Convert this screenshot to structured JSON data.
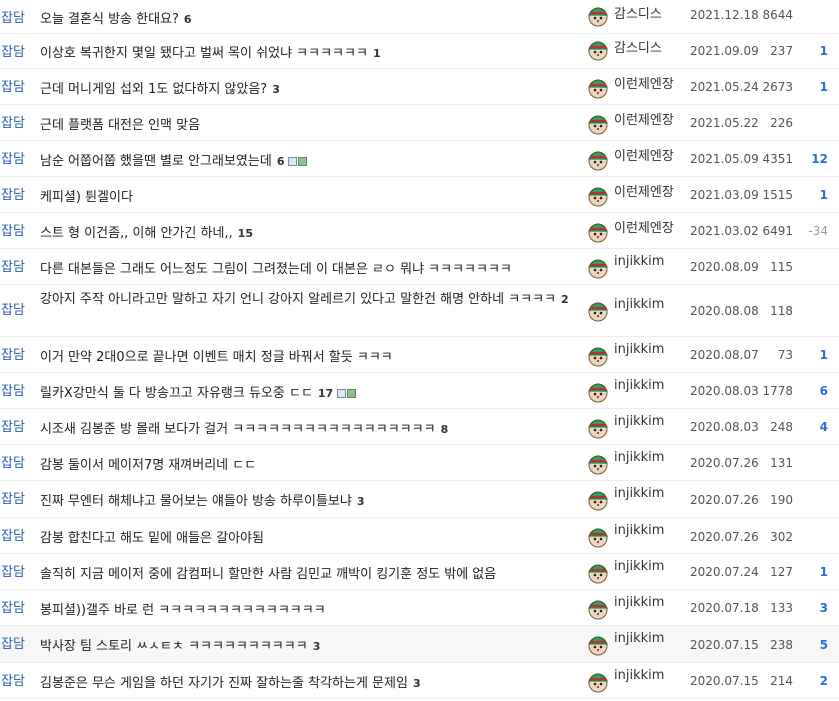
{
  "rows": [
    {
      "category": "잡담",
      "title": "오늘 결혼식 방송 한대요?",
      "comments": "6",
      "attach": false,
      "nick": "감스디스",
      "date": "2021.12.18",
      "views": "8644",
      "rec": ""
    },
    {
      "category": "잡담",
      "title": "이상호 복귀한지 몇일 됐다고 벌써 목이 쉬었냐 ㅋㅋㅋㅋㅋㅋ",
      "comments": "1",
      "attach": false,
      "nick": "감스디스",
      "date": "2021.09.09",
      "views": "237",
      "rec": "1"
    },
    {
      "category": "잡담",
      "title": "근데 머니게임 섭외 1도 없다하지 않았음?",
      "comments": "3",
      "attach": false,
      "nick": "이런제엔장",
      "date": "2021.05.24",
      "views": "2673",
      "rec": "1"
    },
    {
      "category": "잡담",
      "title": "근데 플랫폼 대전은 인맥 맞음",
      "comments": "",
      "attach": false,
      "nick": "이런제엔장",
      "date": "2021.05.22",
      "views": "226",
      "rec": ""
    },
    {
      "category": "잡담",
      "title": "남순 어쭙어쭙 했을땐 별로 안그래보였는데",
      "comments": "6",
      "attach": true,
      "nick": "이런제엔장",
      "date": "2021.05.09",
      "views": "4351",
      "rec": "12"
    },
    {
      "category": "잡담",
      "title": "케피셜) 튄겔이다",
      "comments": "",
      "attach": false,
      "nick": "이런제엔장",
      "date": "2021.03.09",
      "views": "1515",
      "rec": "1"
    },
    {
      "category": "잡담",
      "title": "스트 형 이건좀,, 이해 안가긴 하네,,",
      "comments": "15",
      "attach": false,
      "nick": "이런제엔장",
      "date": "2021.03.02",
      "views": "6491",
      "rec": "-34"
    },
    {
      "category": "잡담",
      "title": "다른 대본들은 그래도 어느정도 그림이 그려졌는데 이 대본은 ㄹㅇ 뭐냐 ㅋㅋㅋㅋㅋㅋㅋ",
      "comments": "",
      "attach": false,
      "nick": "injikkim",
      "date": "2020.08.09",
      "views": "115",
      "rec": ""
    },
    {
      "category": "잡담",
      "title": "강아지 주작 아니라고만 말하고 자기 언니 강아지 알레르기 있다고 말한건 해명 안하네 ㅋㅋㅋㅋ",
      "comments": "2",
      "attach": false,
      "nick": "injikkim",
      "date": "2020.08.08",
      "views": "118",
      "rec": ""
    },
    {
      "category": "잡담",
      "title": "이거 만약 2대0으로 끝나면 이벤트 매치 정글 바꿔서 할듯 ㅋㅋㅋ",
      "comments": "",
      "attach": false,
      "nick": "injikkim",
      "date": "2020.08.07",
      "views": "73",
      "rec": "1"
    },
    {
      "category": "잡담",
      "title": "릴카X강만식 둘 다 방송끄고 자유랭크 듀오중 ㄷㄷ",
      "comments": "17",
      "attach": true,
      "nick": "injikkim",
      "date": "2020.08.03",
      "views": "1778",
      "rec": "6"
    },
    {
      "category": "잡담",
      "title": "시조새 김봉준 방 몰래 보다가 걸거 ㅋㅋㅋㅋㅋㅋㅋㅋㅋㅋㅋㅋㅋㅋㅋㅋㅋ",
      "comments": "8",
      "attach": false,
      "nick": "injikkim",
      "date": "2020.08.03",
      "views": "248",
      "rec": "4"
    },
    {
      "category": "잡담",
      "title": "감봉 둘이서 메이저7명 재껴버리네 ㄷㄷ",
      "comments": "",
      "attach": false,
      "nick": "injikkim",
      "date": "2020.07.26",
      "views": "131",
      "rec": ""
    },
    {
      "category": "잡담",
      "title": "진짜 무엔터 해체냐고 물어보는 얘들아 방송 하루이틀보냐",
      "comments": "3",
      "attach": false,
      "nick": "injikkim",
      "date": "2020.07.26",
      "views": "190",
      "rec": ""
    },
    {
      "category": "잡담",
      "title": "감봉 합친다고 해도 밑에 애들은 갈아야됨",
      "comments": "",
      "attach": false,
      "nick": "injikkim",
      "date": "2020.07.26",
      "views": "302",
      "rec": ""
    },
    {
      "category": "잡담",
      "title": "솔직히 지금 메이저 중에 감컴퍼니 할만한 사람 김민교 깨박이 킹기훈 정도 밖에 없음",
      "comments": "",
      "attach": false,
      "nick": "injikkim",
      "date": "2020.07.24",
      "views": "127",
      "rec": "1"
    },
    {
      "category": "잡담",
      "title": "봉피셜))갤주 바로 런 ㅋㅋㅋㅋㅋㅋㅋㅋㅋㅋㅋㅋㅋㅋ",
      "comments": "",
      "attach": false,
      "nick": "injikkim",
      "date": "2020.07.18",
      "views": "133",
      "rec": "3"
    },
    {
      "category": "잡담",
      "title": "박사장 팀 스토리 ㅆㅅㅌㅊ ㅋㅋㅋㅋㅋㅋㅋㅋㅋㅋ",
      "comments": "3",
      "attach": false,
      "nick": "injikkim",
      "date": "2020.07.15",
      "views": "238",
      "rec": "5"
    },
    {
      "category": "잡담",
      "title": "김봉준은 무슨 게임을 하던 자기가 진짜 잘하는줄 착각하는게 문제임",
      "comments": "3",
      "attach": false,
      "nick": "injikkim",
      "date": "2020.07.15",
      "views": "214",
      "rec": "2"
    }
  ],
  "icons": {
    "avatar": "mushroom-avatar-icon",
    "attachment": "image-file-icon"
  },
  "colors": {
    "category": "#2a5db0",
    "recommend": "#2a6fd6",
    "border": "#ececec"
  }
}
